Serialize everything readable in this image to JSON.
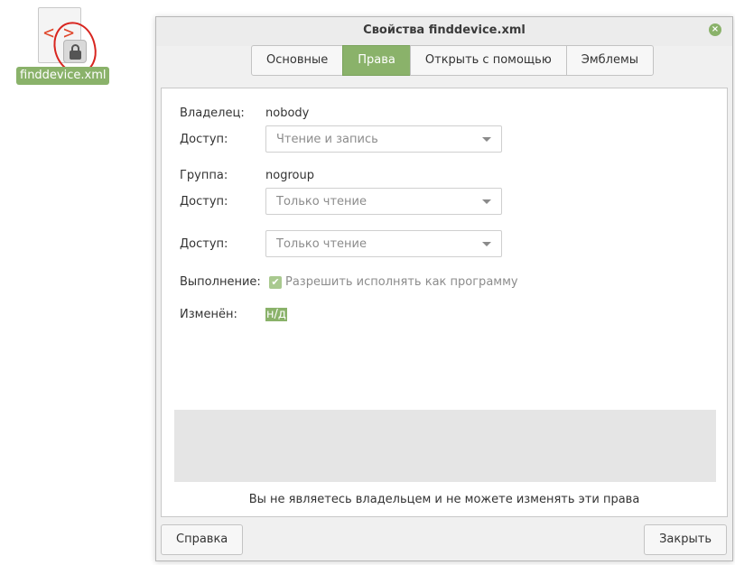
{
  "desktop": {
    "file_name": "finddevice.xml",
    "icon_glyph": "< >"
  },
  "window": {
    "title": "Свойства finddevice.xml",
    "close_glyph": "×"
  },
  "tabs": [
    {
      "label": "Основные",
      "active": false
    },
    {
      "label": "Права",
      "active": true
    },
    {
      "label": "Открыть с помощью",
      "active": false
    },
    {
      "label": "Эмблемы",
      "active": false
    }
  ],
  "permissions": {
    "owner_label": "Владелец:",
    "owner_value": "nobody",
    "owner_access_label": "Доступ:",
    "owner_access_value": "Чтение и запись",
    "group_label": "Группа:",
    "group_value": "nogroup",
    "group_access_label": "Доступ:",
    "group_access_value": "Только чтение",
    "others_access_label": "Доступ:",
    "others_access_value": "Только чтение",
    "execute_label": "Выполнение:",
    "execute_checkbox_label": "Разрешить исполнять как программу",
    "execute_checked": true,
    "modified_label": "Изменён:",
    "modified_value": "н/д"
  },
  "warning_text": "Вы не являетесь владельцем и не можете изменять эти права",
  "buttons": {
    "help": "Справка",
    "close": "Закрыть"
  },
  "colors": {
    "accent": "#8ab26a",
    "annotation_red": "#d8251f",
    "file_icon_code": "#e0462a"
  }
}
